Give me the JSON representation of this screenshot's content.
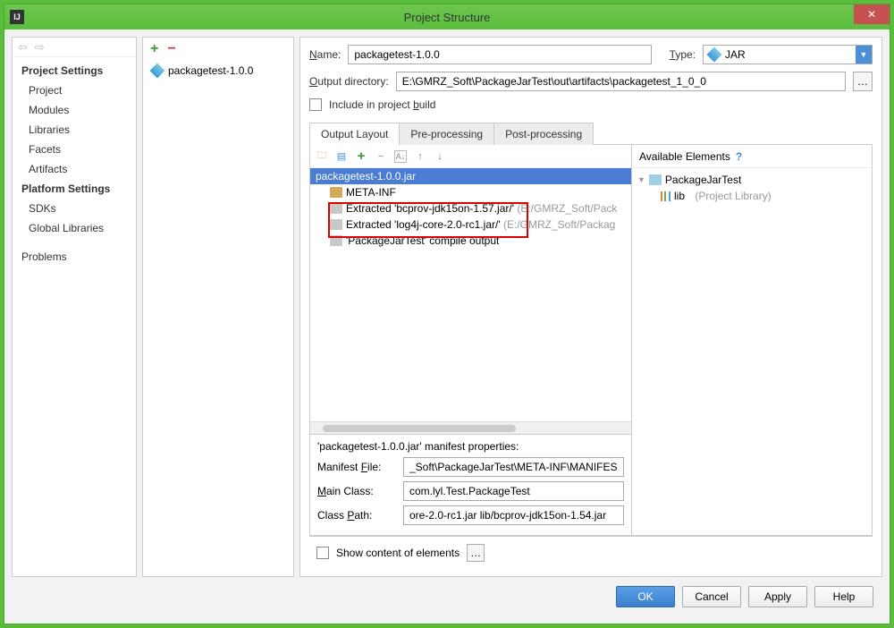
{
  "window": {
    "title": "Project Structure",
    "app_icon": "IJ"
  },
  "left_nav": {
    "project_settings_head": "Project Settings",
    "project": "Project",
    "modules": "Modules",
    "libraries": "Libraries",
    "facets": "Facets",
    "artifacts": "Artifacts",
    "platform_settings_head": "Platform Settings",
    "sdks": "SDKs",
    "global_libraries": "Global Libraries",
    "problems": "Problems"
  },
  "artifact_list": {
    "item0": "packagetest-1.0.0"
  },
  "form": {
    "name_label": "Name:",
    "name_value": "packagetest-1.0.0",
    "type_label": "Type:",
    "type_value": "JAR",
    "outdir_label": "Output directory:",
    "outdir_value": "E:\\GMRZ_Soft\\PackageJarTest\\out\\artifacts\\packagetest_1_0_0",
    "include_label": "Include in project build"
  },
  "tabs": {
    "output_layout": "Output Layout",
    "pre_processing": "Pre-processing",
    "post_processing": "Post-processing"
  },
  "tree": {
    "root": "packagetest-1.0.0.jar",
    "meta_inf": "META-INF",
    "ex1_a": "Extracted 'bcprov-jdk15on-1.57.jar/' ",
    "ex1_b": "(E:/GMRZ_Soft/Pack",
    "ex2_a": "Extracted 'log4j-core-2.0-rc1.jar/' ",
    "ex2_b": "(E:/GMRZ_Soft/Packag",
    "compile": "'PackageJarTest' compile output"
  },
  "available": {
    "head": "Available Elements",
    "help": "?",
    "module": "PackageJarTest",
    "lib": "lib",
    "lib_kind": "(Project Library)"
  },
  "manifest": {
    "head": "'packagetest-1.0.0.jar' manifest properties:",
    "file_label": "Manifest File:",
    "file_value": "_Soft\\PackageJarTest\\META-INF\\MANIFEST",
    "main_label": "Main Class:",
    "main_value": "com.lyl.Test.PackageTest",
    "cp_label": "Class Path:",
    "cp_value": "ore-2.0-rc1.jar lib/bcprov-jdk15on-1.54.jar"
  },
  "show_content": "Show content of elements",
  "buttons": {
    "ok": "OK",
    "cancel": "Cancel",
    "apply": "Apply",
    "help": "Help"
  }
}
